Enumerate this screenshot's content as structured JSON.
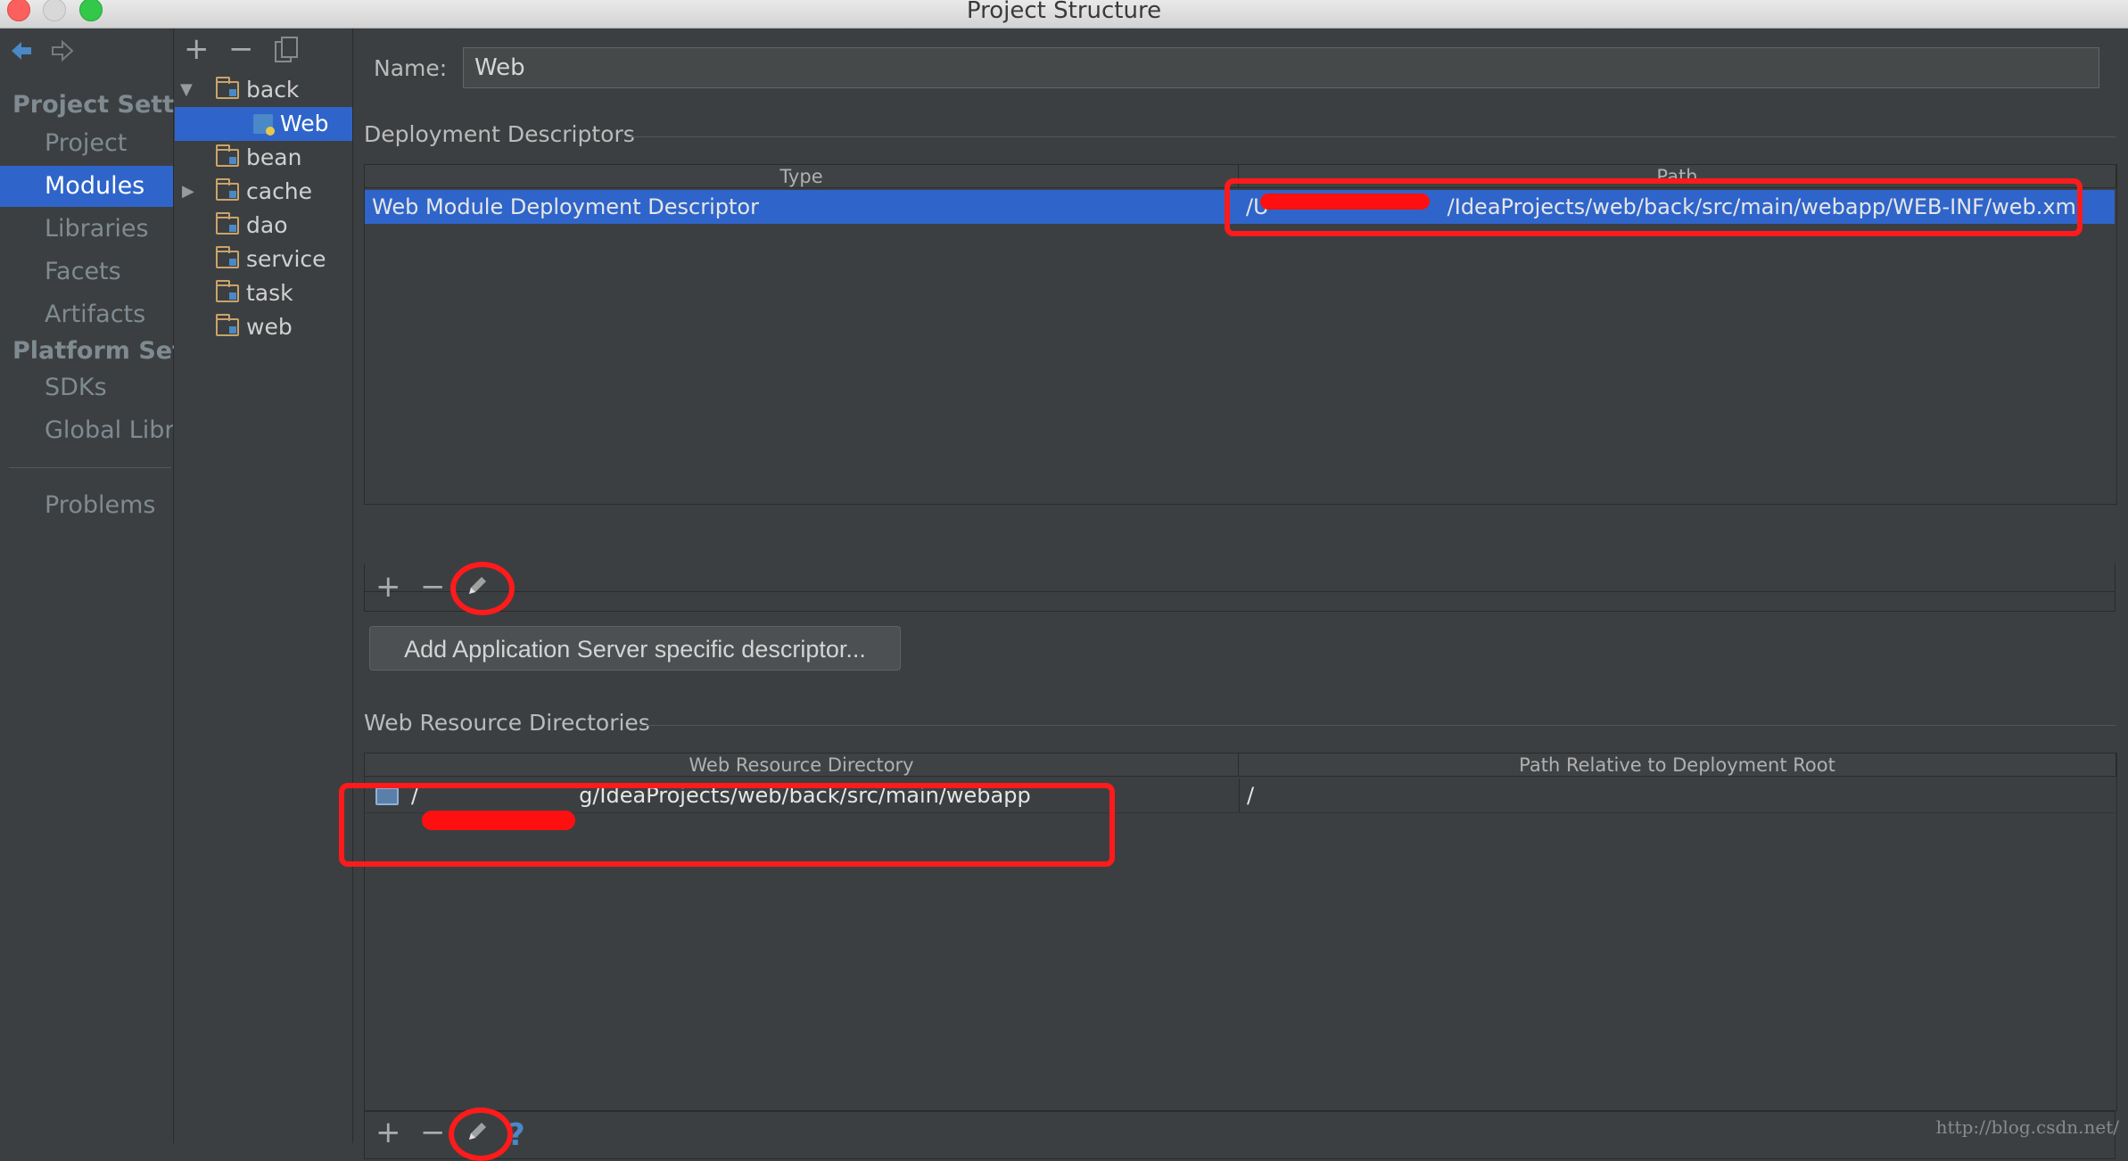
{
  "window": {
    "title": "Project Structure"
  },
  "nav": {
    "project_settings_header": "Project Settings",
    "items_top": [
      {
        "label": "Project"
      },
      {
        "label": "Modules"
      },
      {
        "label": "Libraries"
      },
      {
        "label": "Facets"
      },
      {
        "label": "Artifacts"
      }
    ],
    "platform_settings_header": "Platform Settings",
    "items_platform": [
      {
        "label": "SDKs"
      },
      {
        "label": "Global Libraries"
      }
    ],
    "problems_label": "Problems",
    "selected": "Modules"
  },
  "tree": {
    "items": [
      {
        "label": "back"
      },
      {
        "label": "Web"
      },
      {
        "label": "bean"
      },
      {
        "label": "cache"
      },
      {
        "label": "dao"
      },
      {
        "label": "service"
      },
      {
        "label": "task"
      },
      {
        "label": "web"
      }
    ],
    "selected": "Web"
  },
  "form": {
    "name_label": "Name:",
    "name_value": "Web"
  },
  "deployment": {
    "section_title": "Deployment Descriptors",
    "columns": [
      "Type",
      "Path"
    ],
    "rows": [
      {
        "type": "Web Module Deployment Descriptor",
        "path_prefix": "/U",
        "path_suffix": "/IdeaProjects/web/back/src/main/webapp/WEB-INF/web.xml"
      }
    ],
    "add_server_button": "Add Application Server specific descriptor..."
  },
  "resources": {
    "section_title": "Web Resource Directories",
    "columns": [
      "Web Resource Directory",
      "Path Relative to Deployment Root"
    ],
    "rows": [
      {
        "dir_prefix": "/",
        "dir_suffix": "g/IdeaProjects/web/back/src/main/webapp",
        "relative": "/"
      }
    ]
  },
  "toolbar": {
    "add": "+",
    "remove": "−",
    "help": "?"
  },
  "watermark": "http://blog.csdn.net/",
  "colors": {
    "selection": "#2f65ca",
    "background": "#3c3f41",
    "annotation": "#ff1b1b"
  }
}
